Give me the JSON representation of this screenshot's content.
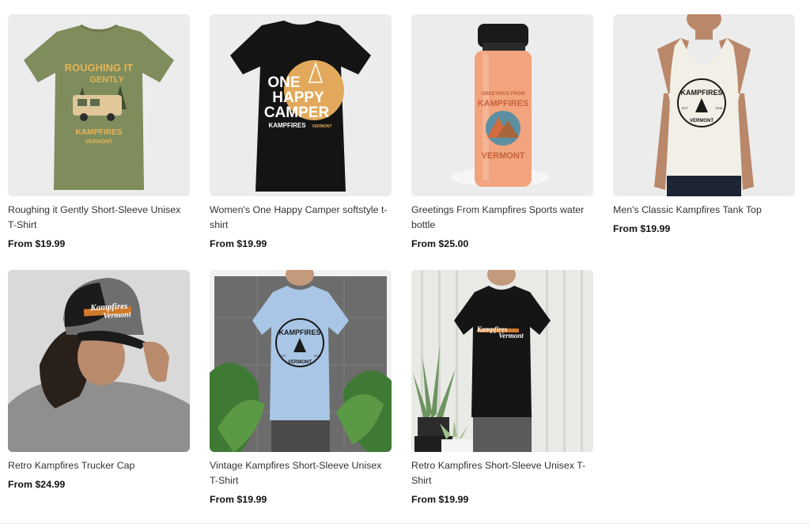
{
  "products": [
    {
      "title": "Roughing it Gently Short-Sleeve Unisex T-Shirt",
      "price": "From $19.99",
      "art": {
        "line1": "ROUGHING IT",
        "line2": "GENTLY",
        "brand": "KAMPFIRES",
        "place": "VERMONT"
      },
      "colors": {
        "shirt": "#7f8c5c",
        "print": "#e5b55a"
      }
    },
    {
      "title": "Women's One Happy Camper softstyle t-shirt",
      "price": "From $19.99",
      "art": {
        "line1": "ONE",
        "line2": "HAPPY",
        "line3": "CAMPER",
        "brand": "KAMPFIRES",
        "place": "VERMONT"
      },
      "colors": {
        "shirt": "#141414",
        "print": "#e2a95c"
      }
    },
    {
      "title": "Greetings From Kampfires Sports water bottle",
      "price": "From $25.00",
      "art": {
        "line1": "GREETINGS FROM",
        "brand": "KAMPFIRES",
        "place": "VERMONT"
      },
      "colors": {
        "bottle": "#f1a47e",
        "cap": "#1a1a1a"
      }
    },
    {
      "title": "Men's Classic Kampfires Tank Top",
      "price": "From $19.99",
      "art": {
        "brand": "KAMPFIRES",
        "place": "VERMONT",
        "est": "EST.",
        "year": "2016"
      },
      "colors": {
        "shirt": "#f2efe6",
        "skin": "#b9876a"
      }
    },
    {
      "title": "Retro Kampfires Trucker Cap",
      "price": "From $24.99",
      "art": {
        "brand": "Kampfires",
        "place": "Vermont"
      },
      "colors": {
        "cap": "#1b1b1b",
        "mesh": "#6e6e6e",
        "sweater": "#8f8f8f"
      }
    },
    {
      "title": "Vintage Kampfires Short-Sleeve Unisex T-Shirt",
      "price": "From $19.99",
      "art": {
        "brand": "KAMPFIRES",
        "place": "VERMONT",
        "est": "EST.",
        "year": "2016"
      },
      "colors": {
        "shirt": "#a9c6e6",
        "wall": "#6c6c6c"
      }
    },
    {
      "title": "Retro Kampfires Short-Sleeve Unisex T-Shirt",
      "price": "From $19.99",
      "art": {
        "brand": "Kampfires",
        "place": "Vermont"
      },
      "colors": {
        "shirt": "#151515",
        "wall": "#e9e9e6"
      }
    }
  ]
}
